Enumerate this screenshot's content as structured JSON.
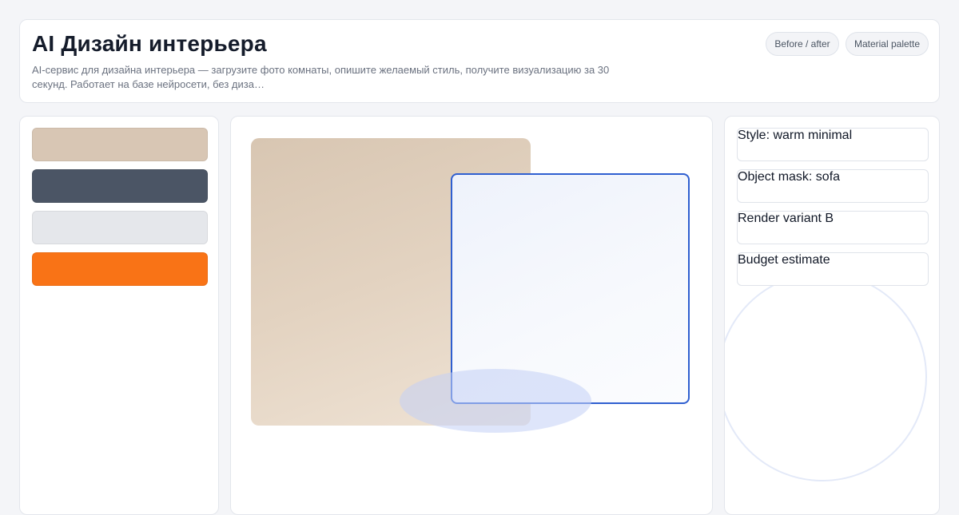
{
  "header": {
    "title": "AI Дизайн интерьера",
    "subtitle": "AI-сервис для дизайна интерьера — загрузите фото комнаты, опишите желаемый стиль, получите визуализацию за 30 секунд. Работает на базе нейросети, без диза…",
    "chips": [
      "Before / after",
      "Material palette"
    ]
  },
  "palette": {
    "swatches": [
      {
        "name": "beige",
        "color": "#d8c6b4"
      },
      {
        "name": "slate",
        "color": "#4b5565"
      },
      {
        "name": "light-gray",
        "color": "#e5e7eb"
      },
      {
        "name": "orange",
        "color": "#f97316"
      }
    ]
  },
  "details": {
    "items": [
      "Style: warm minimal",
      "Object mask: sofa",
      "Render variant B",
      "Budget estimate"
    ]
  },
  "colors": {
    "accent": "#2f5fd0",
    "background": "#f4f5f8"
  }
}
